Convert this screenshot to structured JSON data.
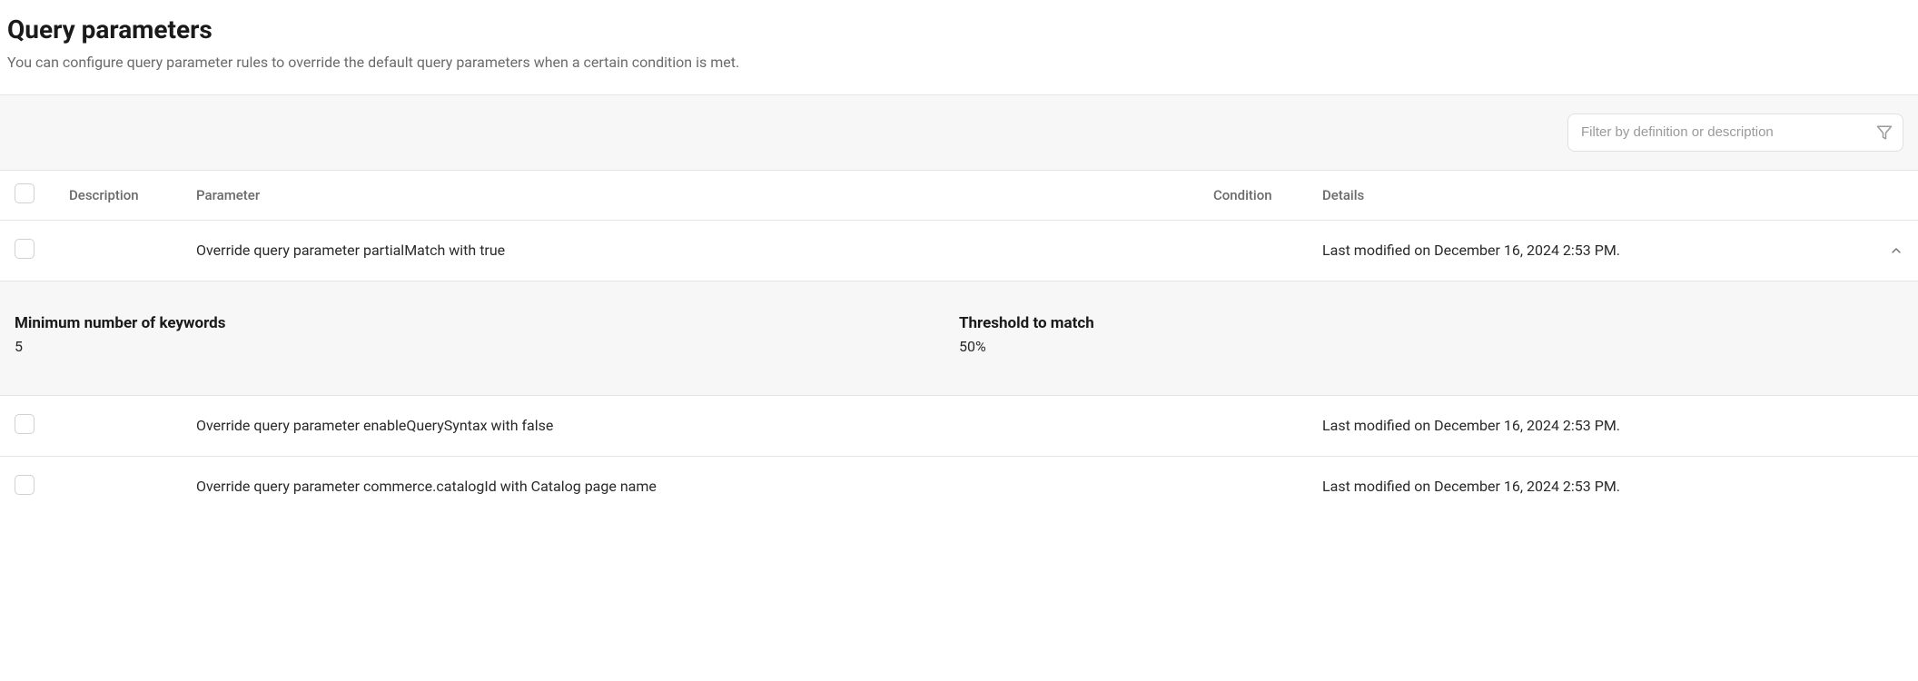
{
  "header": {
    "title": "Query parameters",
    "subtitle": "You can configure query parameter rules to override the default query parameters when a certain condition is met."
  },
  "toolbar": {
    "filter_placeholder": "Filter by definition or description"
  },
  "table": {
    "columns": {
      "description": "Description",
      "parameter": "Parameter",
      "condition": "Condition",
      "details": "Details"
    },
    "rows": [
      {
        "description": "",
        "parameter": "Override query parameter partialMatch with true",
        "condition": "",
        "details": "Last modified on December 16, 2024 2:53 PM.",
        "expanded": true,
        "panel": {
          "min_keywords_label": "Minimum number of keywords",
          "min_keywords_value": "5",
          "threshold_label": "Threshold to match",
          "threshold_value": "50%"
        }
      },
      {
        "description": "",
        "parameter": "Override query parameter enableQuerySyntax with false",
        "condition": "",
        "details": "Last modified on December 16, 2024 2:53 PM.",
        "expanded": false
      },
      {
        "description": "",
        "parameter": "Override query parameter commerce.catalogId with Catalog page name",
        "condition": "",
        "details": "Last modified on December 16, 2024 2:53 PM.",
        "expanded": false
      }
    ]
  }
}
